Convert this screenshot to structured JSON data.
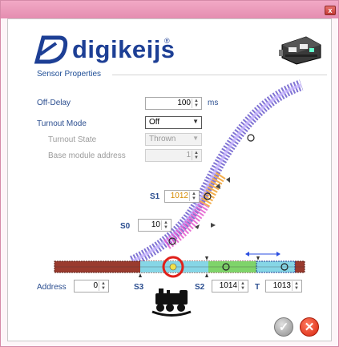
{
  "window": {
    "close_glyph": "x"
  },
  "header": {
    "logo_text": "digikeijs",
    "logo_reg": "®",
    "logo_icon": "digikeijs-d-logo-icon",
    "device_icon": "decoder-module-icon"
  },
  "group": {
    "title": "Sensor Properties"
  },
  "fields": {
    "off_delay": {
      "label": "Off-Delay",
      "value": "100",
      "unit": "ms"
    },
    "turnout_mode": {
      "label": "Turnout Mode",
      "value": "Off"
    },
    "turnout_state": {
      "label": "Turnout State",
      "value": "Thrown"
    },
    "base_module": {
      "label": "Base module address",
      "value": "1"
    },
    "address": {
      "label": "Address",
      "value": "0"
    }
  },
  "sensors": {
    "s1": {
      "label": "S1",
      "value": "1012"
    },
    "s0": {
      "label": "S0",
      "value": "10"
    },
    "s3": {
      "label": "S3"
    },
    "s2": {
      "label": "S2",
      "value": "1014"
    },
    "t": {
      "label": "T",
      "value": "1013"
    }
  },
  "diagram": {
    "train_icon": "locomotive-icon",
    "arrow_icon": "double-arrow-icon"
  },
  "colors": {
    "accent": "#1d3f95",
    "title_bar": "#e48db0",
    "track_active": "#7fd6e6",
    "ok_button": "#9a9a9a",
    "cancel_button": "#e03a1c"
  }
}
